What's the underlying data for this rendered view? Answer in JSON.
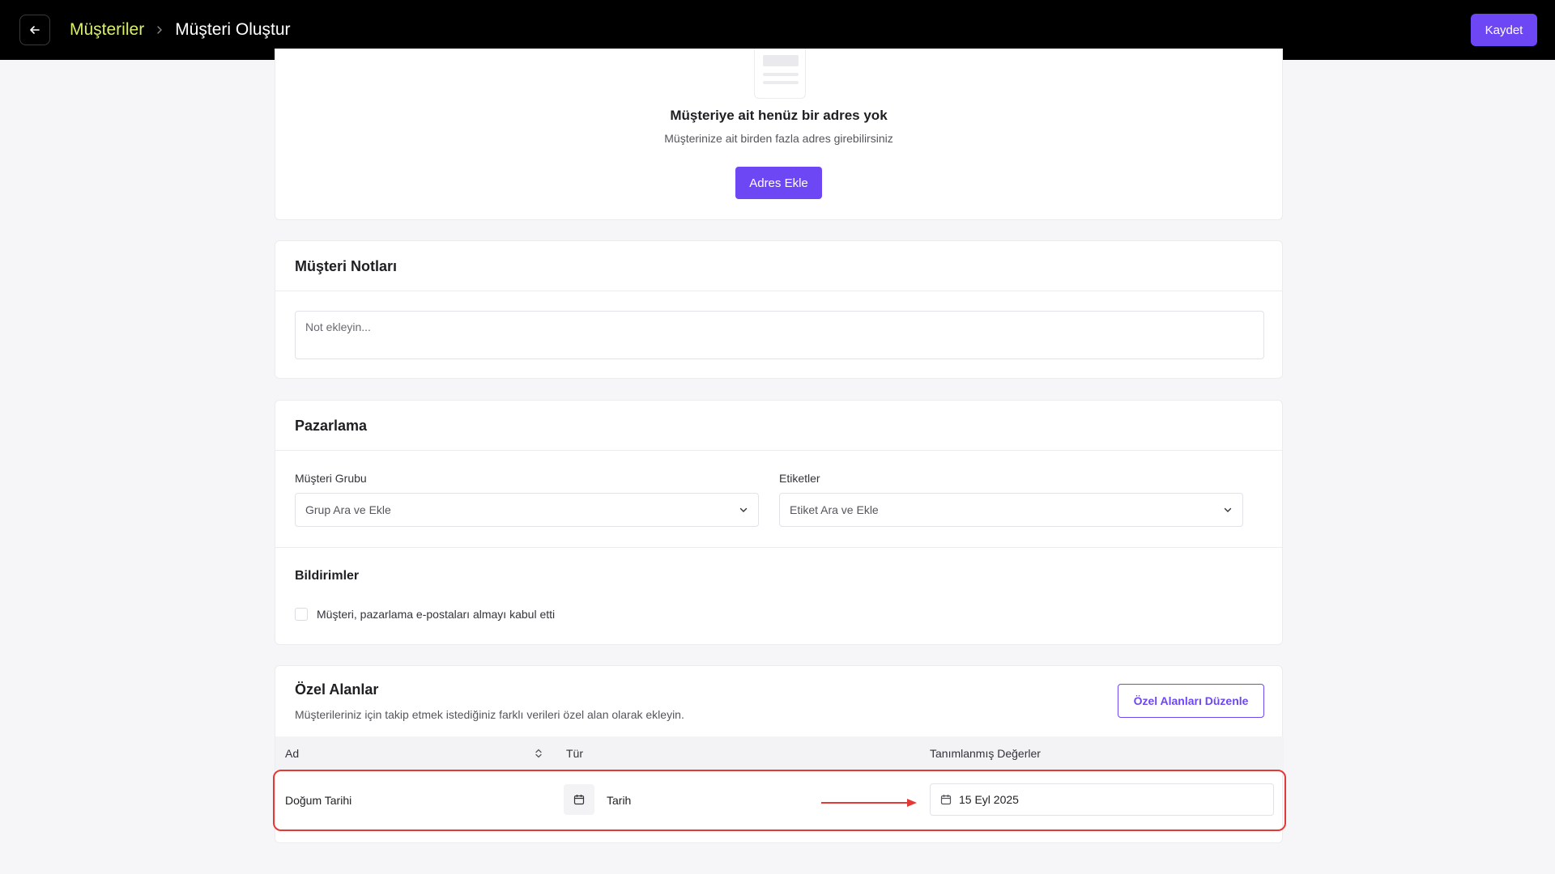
{
  "header": {
    "breadcrumb_parent": "Müşteriler",
    "breadcrumb_current": "Müşteri Oluştur",
    "save_label": "Kaydet"
  },
  "address": {
    "empty_title": "Müşteriye ait henüz bir adres yok",
    "empty_subtitle": "Müşterinize ait birden fazla adres girebilirsiniz",
    "add_label": "Adres Ekle"
  },
  "notes": {
    "title": "Müşteri Notları",
    "placeholder": "Not ekleyin..."
  },
  "marketing": {
    "title": "Pazarlama",
    "group_label": "Müşteri Grubu",
    "group_placeholder": "Grup Ara ve Ekle",
    "tags_label": "Etiketler",
    "tags_placeholder": "Etiket Ara ve Ekle",
    "notifications_title": "Bildirimler",
    "email_consent_label": "Müşteri, pazarlama e-postaları almayı kabul etti",
    "email_consent_checked": false
  },
  "custom_fields": {
    "title": "Özel Alanlar",
    "subtitle": "Müşterileriniz için takip etmek istediğiniz farklı verileri özel alan olarak ekleyin.",
    "edit_label": "Özel Alanları Düzenle",
    "columns": [
      "Ad",
      "Tür",
      "Tanımlanmış Değerler"
    ],
    "rows": [
      {
        "name": "Doğum Tarihi",
        "type": "Tarih",
        "type_icon": "calendar-icon",
        "value": "15 Eyl 2025"
      }
    ]
  },
  "colors": {
    "brand": "#6e47f5",
    "breadcrumb_link": "#d8ef6a",
    "highlight": "#e53935",
    "header_bg": "#000000"
  }
}
